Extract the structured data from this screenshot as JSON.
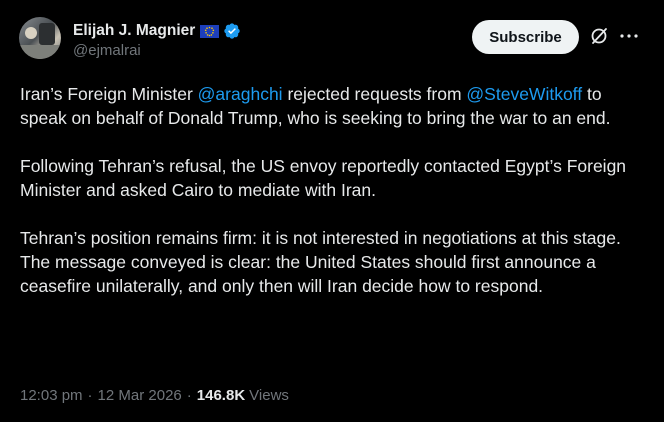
{
  "author": {
    "name": "Elijah J. Magnier",
    "handle": "@ejmalrai",
    "flag_icon": "eu-flag-icon",
    "verified_icon": "verified-badge-icon"
  },
  "actions": {
    "subscribe_label": "Subscribe",
    "grok_icon": "grok-icon",
    "more_icon": "more-options-icon"
  },
  "tweet": {
    "p1": {
      "t1": "Iran’s Foreign Minister ",
      "m1": "@araghchi",
      "t2": " rejected requests from ",
      "m2": "@SteveWitkoff",
      "t3": " to speak on behalf of Donald Trump, who is seeking to bring the war to an end."
    },
    "p2": "Following Tehran’s refusal, the US envoy reportedly contacted Egypt’s Foreign Minister and asked Cairo to mediate with Iran.",
    "p3": "Tehran’s position remains firm: it is not interested in negotiations at this stage. The message conveyed is clear: the United States should first announce a ceasefire unilaterally, and only then will Iran decide how to respond."
  },
  "meta": {
    "time": "12:03 pm",
    "sep1": "·",
    "date": "12 Mar 2026",
    "sep2": "·",
    "views_count": "146.8K",
    "views_label": "Views"
  },
  "colors": {
    "background": "#000000",
    "text": "#e7e9ea",
    "muted": "#71767b",
    "link": "#1d9bf0",
    "verified": "#1d9bf0",
    "eu_blue": "#1d3fbb",
    "eu_star": "#ffcc00"
  }
}
